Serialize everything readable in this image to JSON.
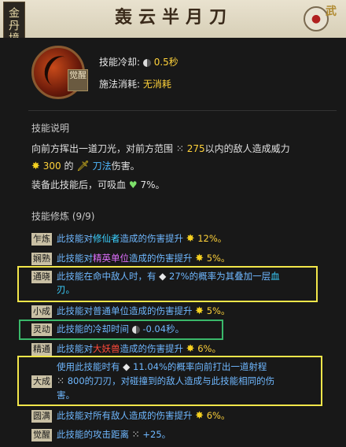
{
  "realm": "金丹境",
  "title": "轰云半月刀",
  "corner_text": "武",
  "awaken_label": "觉醒",
  "cooldown": {
    "label": "技能冷却:",
    "value": "0.5秒"
  },
  "cost": {
    "label": "施法消耗:",
    "value": "无消耗"
  },
  "desc": {
    "title": "技能说明",
    "line1_prefix": "向前方挥出一道刀光，对前方范围",
    "range": "275",
    "line1_suffix": "以内的敌人造成威力",
    "power": "300",
    "de": "的",
    "dao_label": "刀法",
    "line2_suffix": "伤害。",
    "line3_prefix": "装备此技能后，可吸血",
    "leech": "7%。"
  },
  "training": {
    "title": "技能修炼 (9/9)",
    "rows": [
      {
        "tag": "乍炼",
        "text_a": "此技能对",
        "hl": "修仙者",
        "text_b": "造成的伤害提升",
        "val": "12%。"
      },
      {
        "tag": "娴熟",
        "text_a": "此技能对",
        "hl": "精英单位",
        "text_b": "造成的伤害提升",
        "val": "5%。"
      },
      {
        "tag": "通晓",
        "line1": "此技能在命中敌人时，有",
        "val1": "27%的概率为其叠加一层",
        "hl": "血",
        "line2": "刃。"
      },
      {
        "tag": "小成",
        "text_a": "此技能对普通单位造成的伤害提升",
        "val": "5%。"
      },
      {
        "tag": "灵动",
        "text_a": "此技能的冷却时间",
        "val": "-0.04秒。"
      },
      {
        "tag": "精通",
        "text_a": "此技能对",
        "hl": "大妖兽",
        "text_b": "造成的伤害提升",
        "val": "6%。"
      },
      {
        "tag": "大成",
        "line1_a": "使用此技能时有",
        "line1_b": "11.04%的概率向前打出一道射程",
        "line2_a": "800的刀刃，对碰撞到的敌人造成与此技能相同的伤",
        "line3": "害。"
      },
      {
        "tag": "圆满",
        "text_a": "此技能对所有敌人造成的伤害提升",
        "val": "6%。"
      },
      {
        "tag": "觉醒",
        "text_a": "此技能的攻击距离",
        "val": "+25。"
      }
    ]
  }
}
